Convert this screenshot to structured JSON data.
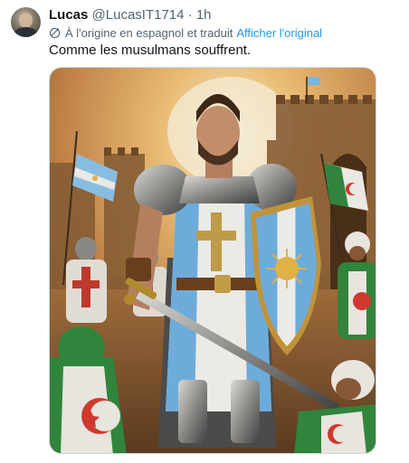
{
  "tweet": {
    "author_name": "Lucas",
    "author_handle": "@LucasIT1714",
    "separator": "·",
    "time": "1h",
    "translation_note": "À l'origine en espagnol et traduit",
    "show_original_label": "Afficher l'original",
    "text": "Comme les musulmans souffrent."
  },
  "icons": {
    "translate": "globe-translate-icon"
  },
  "colors": {
    "link": "#1d9bf0",
    "secondary_text": "#536471",
    "primary_text": "#0f1419",
    "media_border": "#cfd9de"
  }
}
